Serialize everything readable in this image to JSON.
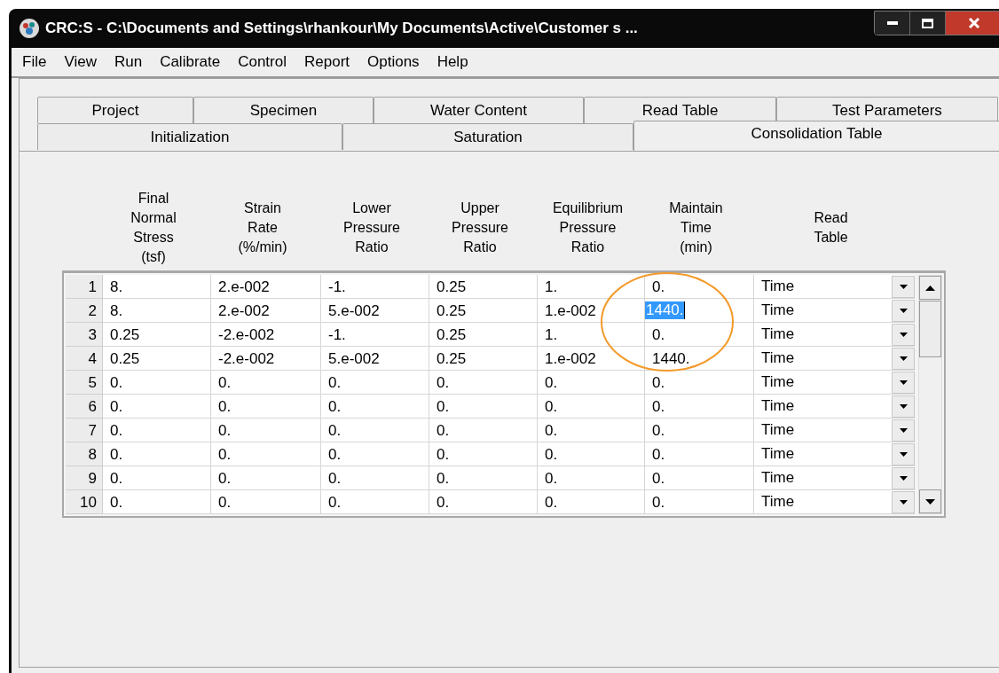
{
  "window": {
    "title": "CRC:S - C:\\Documents and Settings\\rhankour\\My Documents\\Active\\Customer s ..."
  },
  "menu": [
    "File",
    "View",
    "Run",
    "Calibrate",
    "Control",
    "Report",
    "Options",
    "Help"
  ],
  "tab_rows": [
    [
      {
        "label": "Project",
        "selected": false
      },
      {
        "label": "Specimen",
        "selected": false
      },
      {
        "label": "Water Content",
        "selected": false
      },
      {
        "label": "Read Table",
        "selected": false
      },
      {
        "label": "Test Parameters",
        "selected": false
      }
    ],
    [
      {
        "label": "Initialization",
        "selected": false
      },
      {
        "label": "Saturation",
        "selected": false
      },
      {
        "label": "Consolidation Table",
        "selected": true
      }
    ]
  ],
  "table": {
    "columns": [
      "Final\nNormal\nStress\n(tsf)",
      "Strain\nRate\n(%/min)",
      "Lower\nPressure\nRatio",
      "Upper\nPressure\nRatio",
      "Equilibrium\nPressure\nRatio",
      "Maintain\nTime\n(min)",
      "Read\nTable"
    ],
    "rows": [
      {
        "number": "1",
        "cells": [
          "8.",
          "2.e-002",
          "-1.",
          "0.25",
          "1."
        ],
        "maintain_time": {
          "text": "0.",
          "selected": false
        },
        "read_table": "Time"
      },
      {
        "number": "2",
        "cells": [
          "8.",
          "2.e-002",
          "5.e-002",
          "0.25",
          "1.e-002"
        ],
        "maintain_time": {
          "text": "1440.",
          "selected": true
        },
        "read_table": "Time"
      },
      {
        "number": "3",
        "cells": [
          "0.25",
          "-2.e-002",
          "-1.",
          "0.25",
          "1."
        ],
        "maintain_time": {
          "text": "0.",
          "selected": false
        },
        "read_table": "Time"
      },
      {
        "number": "4",
        "cells": [
          "0.25",
          "-2.e-002",
          "5.e-002",
          "0.25",
          "1.e-002"
        ],
        "maintain_time": {
          "text": "1440.",
          "selected": false
        },
        "read_table": "Time"
      },
      {
        "number": "5",
        "cells": [
          "0.",
          "0.",
          "0.",
          "0.",
          "0."
        ],
        "maintain_time": {
          "text": "0.",
          "selected": false
        },
        "read_table": "Time"
      },
      {
        "number": "6",
        "cells": [
          "0.",
          "0.",
          "0.",
          "0.",
          "0."
        ],
        "maintain_time": {
          "text": "0.",
          "selected": false
        },
        "read_table": "Time"
      },
      {
        "number": "7",
        "cells": [
          "0.",
          "0.",
          "0.",
          "0.",
          "0."
        ],
        "maintain_time": {
          "text": "0.",
          "selected": false
        },
        "read_table": "Time"
      },
      {
        "number": "8",
        "cells": [
          "0.",
          "0.",
          "0.",
          "0.",
          "0."
        ],
        "maintain_time": {
          "text": "0.",
          "selected": false
        },
        "read_table": "Time"
      },
      {
        "number": "9",
        "cells": [
          "0.",
          "0.",
          "0.",
          "0.",
          "0."
        ],
        "maintain_time": {
          "text": "0.",
          "selected": false
        },
        "read_table": "Time"
      },
      {
        "number": "10",
        "cells": [
          "0.",
          "0.",
          "0.",
          "0.",
          "0."
        ],
        "maintain_time": {
          "text": "0.",
          "selected": false
        },
        "read_table": "Time"
      }
    ]
  }
}
